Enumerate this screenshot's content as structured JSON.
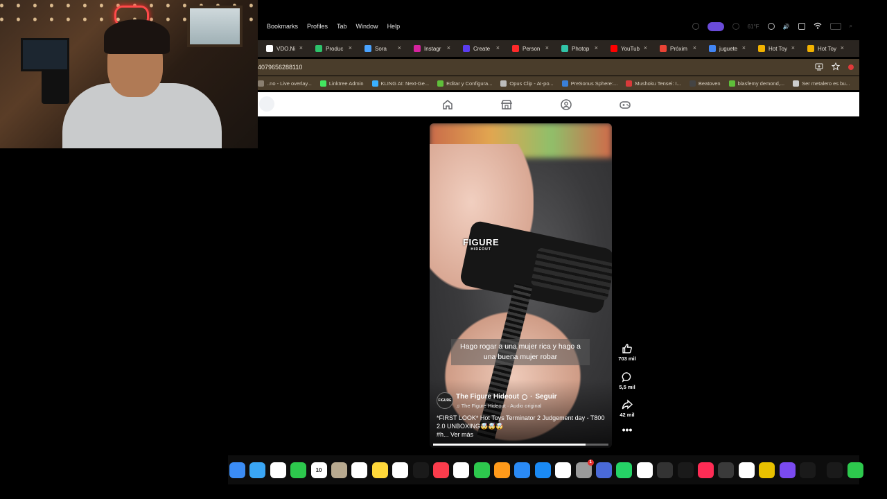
{
  "menubar": {
    "items": [
      "Bookmarks",
      "Profiles",
      "Tab",
      "Window",
      "Help"
    ],
    "temperature": "61°F"
  },
  "tabs": [
    {
      "label": "VDO.Ni",
      "color": "#ffffff"
    },
    {
      "label": "Produc",
      "color": "#2dc26b"
    },
    {
      "label": "Sora",
      "color": "#4aa3ff"
    },
    {
      "label": "Instagr",
      "color": "#d6249f"
    },
    {
      "label": "Create",
      "color": "#5a3df0"
    },
    {
      "label": "Person",
      "color": "#ff2a2a"
    },
    {
      "label": "Photop",
      "color": "#31c4a8"
    },
    {
      "label": "YouTub",
      "color": "#ff0000"
    },
    {
      "label": "Próxim",
      "color": "#ea4335"
    },
    {
      "label": "juguete",
      "color": "#4285f4"
    },
    {
      "label": "Hot Toy",
      "color": "#f2b200"
    },
    {
      "label": "Hot Toy",
      "color": "#f2b200"
    }
  ],
  "address": {
    "url": "4079656288110"
  },
  "bookmarks": [
    {
      "label": "..no - Live overlay...",
      "color": "#8a7f70"
    },
    {
      "label": "Linktree Admin",
      "color": "#43e660"
    },
    {
      "label": "KLING AI: Next-Ge...",
      "color": "#3ab0ff"
    },
    {
      "label": "Editar y Configura...",
      "color": "#5fbf3a"
    },
    {
      "label": "Opus Clip - AI-po...",
      "color": "#bbbbbb"
    },
    {
      "label": "PreSonus Sphere:...",
      "color": "#3a7fd8"
    },
    {
      "label": "Mushoku Tensei: I...",
      "color": "#d83a3a"
    },
    {
      "label": "Beatoven",
      "color": "#444444"
    },
    {
      "label": "blasfemy demond,...",
      "color": "#5fbf3a"
    },
    {
      "label": "Ser metalero es bu...",
      "color": "#cccccc"
    }
  ],
  "reel": {
    "watermark": "FIGURE",
    "watermark_sub": "HIDEOUT",
    "caption": "Hago rogar a una mujer rica y hago a una buena mujer robar",
    "avatar_text": "FIGURE",
    "author": "The Figure Hideout",
    "follow": "Seguir",
    "audio": "The Figure Hideout · Audio original",
    "description": "*FIRST LOOK* Hot Toys Terminator 2 Judgement day - T800 2.0 UNBOXING🤯🤯🤯",
    "hashtag": "#h...",
    "see_more": "Ver más",
    "progress": 0.87
  },
  "actions": {
    "likes": "703 mil",
    "comments": "5,5 mil",
    "shares": "42 mil"
  },
  "dock": {
    "calendar_day": "10",
    "notification_badge": "1",
    "apps": [
      {
        "name": "mail",
        "color": "#3b8cf5"
      },
      {
        "name": "safari",
        "color": "#3aa6f5"
      },
      {
        "name": "photos",
        "color": "#ffffff"
      },
      {
        "name": "facetime",
        "color": "#2dc84d"
      },
      {
        "name": "calendar",
        "color": "#ffffff"
      },
      {
        "name": "contacts",
        "color": "#b8a98f"
      },
      {
        "name": "reminders",
        "color": "#ffffff"
      },
      {
        "name": "notes",
        "color": "#ffd83a"
      },
      {
        "name": "freeform",
        "color": "#ffffff"
      },
      {
        "name": "tv",
        "color": "#1a1a1a"
      },
      {
        "name": "music",
        "color": "#fa3c4c"
      },
      {
        "name": "news",
        "color": "#ffffff"
      },
      {
        "name": "numbers",
        "color": "#2dc84d"
      },
      {
        "name": "pages",
        "color": "#ff9a1a"
      },
      {
        "name": "keynote",
        "color": "#2a8af5"
      },
      {
        "name": "app-store",
        "color": "#1a8af5"
      },
      {
        "name": "capcut",
        "color": "#ffffff"
      },
      {
        "name": "system-settings",
        "color": "#9a9a9a"
      },
      {
        "name": "simulator",
        "color": "#4a6ad8"
      },
      {
        "name": "whatsapp",
        "color": "#25d366"
      },
      {
        "name": "chrome",
        "color": "#ffffff"
      },
      {
        "name": "opera",
        "color": "#333333"
      },
      {
        "name": "cleanshot",
        "color": "#1a1a1a"
      },
      {
        "name": "tiktok",
        "color": "#fe2c55"
      },
      {
        "name": "pencil-app",
        "color": "#3a3a3a"
      },
      {
        "name": "chatgpt",
        "color": "#ffffff"
      },
      {
        "name": "among-us",
        "color": "#e8c000"
      },
      {
        "name": "launchpad",
        "color": "#7a4af0"
      },
      {
        "name": "waveform-app",
        "color": "#1a1a1a"
      },
      {
        "name": "waveform-app-2",
        "color": "#1a1a1a"
      },
      {
        "name": "phone",
        "color": "#2dc84d"
      }
    ]
  }
}
